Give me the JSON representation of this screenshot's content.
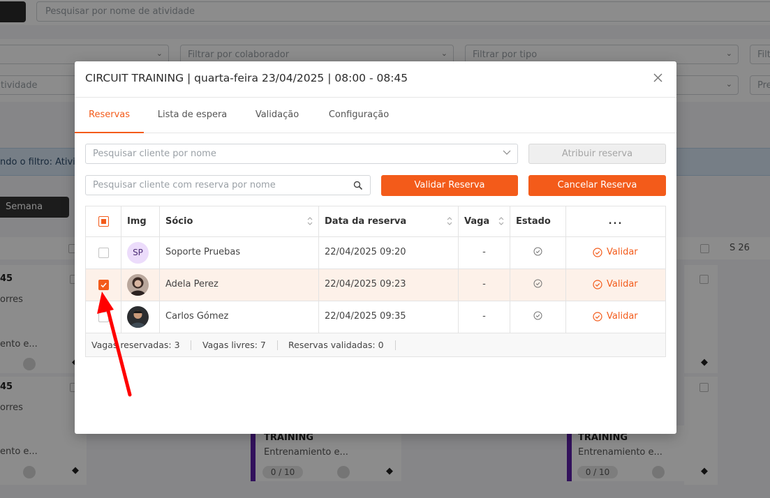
{
  "background": {
    "search_placeholder": "Pesquisar por nome de atividade",
    "filter_collaborator": "Filtrar por colaborador",
    "filter_type": "Filtrar por tipo",
    "filter_cut_right": "Filt",
    "filter_activity_cut": "tividade",
    "filter_cut_right2": "Pre",
    "info_text": "ndo o filtro: Ativid",
    "week_button": "Semana",
    "week_label": "S 26",
    "cards": [
      {
        "time": "45",
        "name": "orres",
        "desc": "ento e..."
      },
      {
        "time": "45",
        "name": "orres",
        "desc": "ento e..."
      }
    ],
    "training_cards": [
      {
        "title": "TRAINING",
        "desc": "Entrenamiento e...",
        "count": "0 / 10"
      },
      {
        "title": "TRAINING",
        "desc": "Entrenamiento e...",
        "count": "0 / 10"
      }
    ]
  },
  "modal": {
    "title": "CIRCUIT TRAINING | quarta-feira 23/04/2025 | 08:00 - 08:45",
    "tabs": [
      {
        "label": "Reservas",
        "active": true
      },
      {
        "label": "Lista de espera",
        "active": false
      },
      {
        "label": "Validação",
        "active": false
      },
      {
        "label": "Configuração",
        "active": false
      }
    ],
    "client_select_placeholder": "Pesquisar cliente por nome",
    "assign_button": "Atribuir reserva",
    "reserved_search_placeholder": "Pesquisar cliente com reserva por nome",
    "validate_button": "Validar Reserva",
    "cancel_button": "Cancelar Reserva",
    "table": {
      "columns": [
        "Img",
        "Sócio",
        "Data da reserva",
        "Vaga",
        "Estado",
        "..."
      ],
      "rows": [
        {
          "initials": "SP",
          "name": "Soporte Pruebas",
          "date": "22/04/2025 09:20",
          "vaga": "-",
          "action": "Validar",
          "checked": false
        },
        {
          "initials": "",
          "name": "Adela Perez",
          "date": "22/04/2025 09:23",
          "vaga": "-",
          "action": "Validar",
          "checked": true
        },
        {
          "initials": "",
          "name": "Carlos Gómez",
          "date": "22/04/2025 09:35",
          "vaga": "-",
          "action": "Validar",
          "checked": false
        }
      ],
      "footer": {
        "reserved": "Vagas reservadas: 3",
        "free": "Vagas livres: 7",
        "validated": "Reservas validadas: 0"
      }
    }
  },
  "colors": {
    "accent": "#f35b1a",
    "selected_row": "#fdf1e9",
    "arrow": "#ff0000"
  }
}
